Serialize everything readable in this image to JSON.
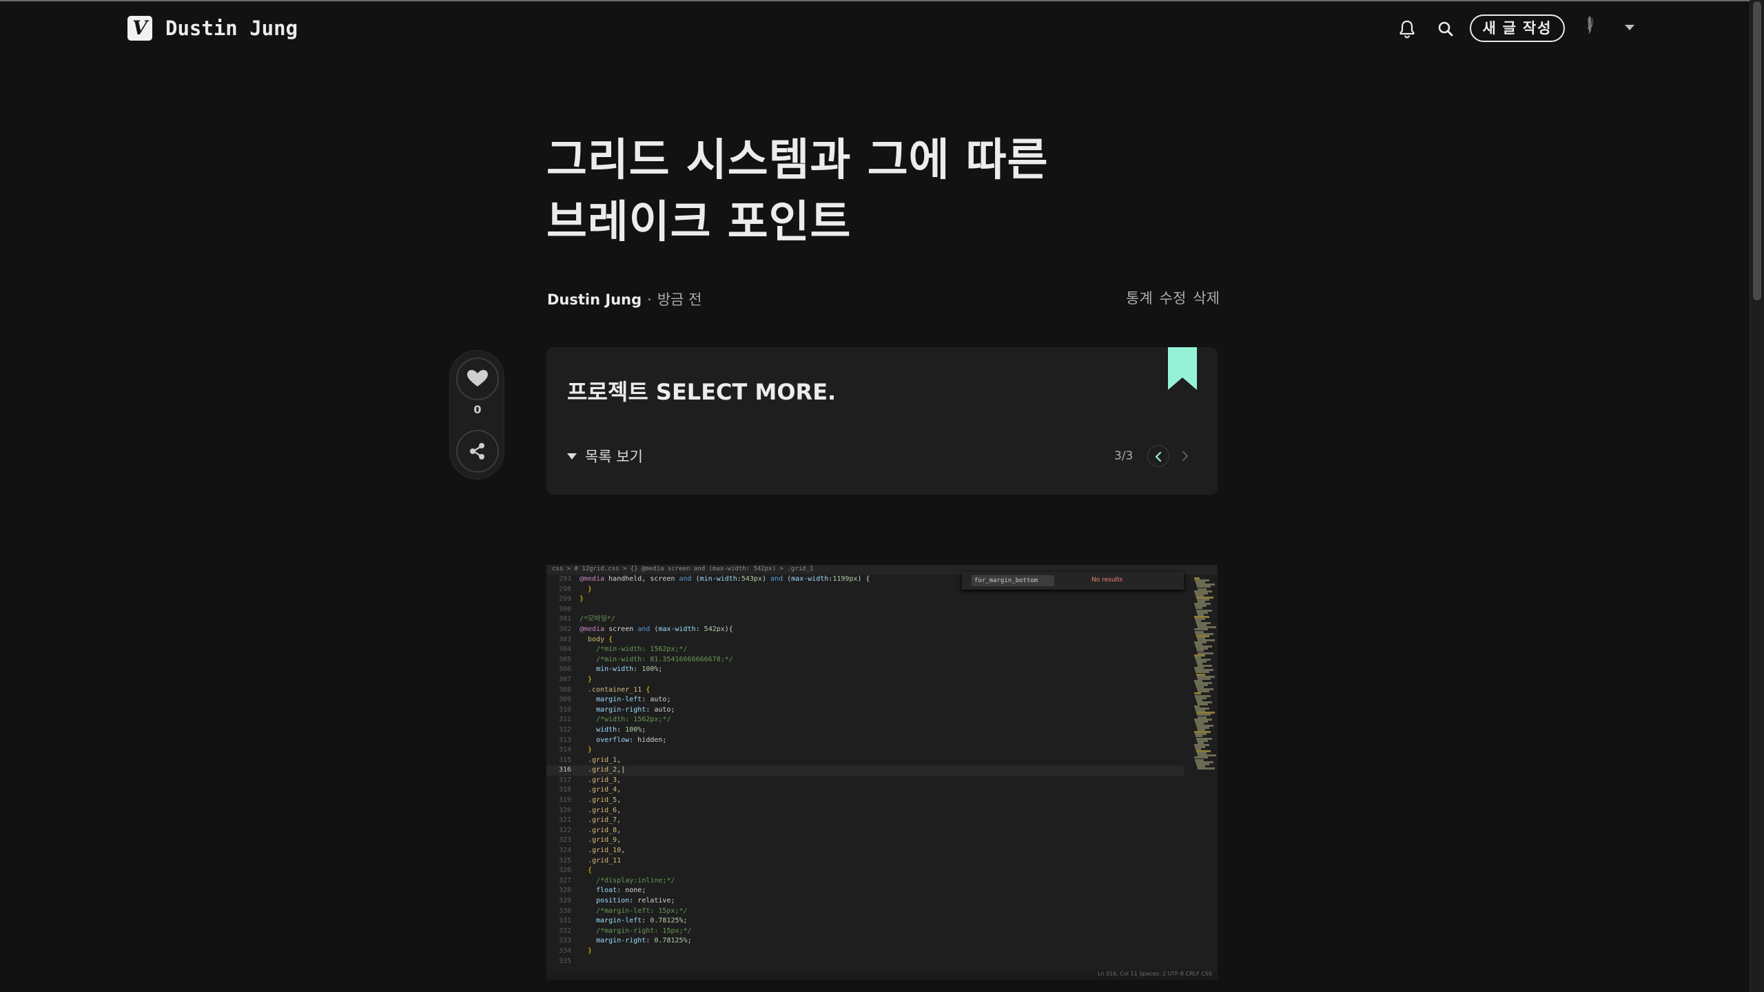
{
  "header": {
    "logo_letter": "V",
    "blog_title": "Dustin Jung",
    "new_post_label": "새 글 작성",
    "icons": [
      "bell-icon",
      "search-icon",
      "chevron-down-icon"
    ]
  },
  "post": {
    "title_line1": "그리드 시스템과 그에 따른",
    "title_line2": "브레이크 포인트",
    "author": "Dustin Jung",
    "separator": "·",
    "time": "방금 전",
    "actions": {
      "stats": "통계",
      "edit": "수정",
      "delete": "삭제"
    }
  },
  "side_actions": {
    "like_count": "0"
  },
  "series": {
    "name": "프로젝트 SELECT MORE.",
    "toc_label": "목록 보기",
    "progress": "3/3"
  },
  "code_image": {
    "breadcrumb": "css > # 12grid.css > {} @media screen and (max-width: 542px) > .grid_1",
    "find_query": "for_margin_bottom",
    "find_status": "No results",
    "status_text": "Ln 316, Col 11   Spaces: 2   UTF-8   CRLF   CSS",
    "lines": [
      {
        "n": "293",
        "html": "<span class='c-at'>@media</span> <span class='c-plain'>handheld, screen</span> <span class='c-kw'>and</span> <span class='c-plain'>(</span><span class='c-prop'>min-width</span><span class='c-plain'>:</span><span class='c-num'>543px</span><span class='c-plain'>)</span> <span class='c-kw'>and</span> <span class='c-plain'>(</span><span class='c-prop'>max-width</span><span class='c-plain'>:</span><span class='c-num'>1199px</span><span class='c-plain'>) {</span>"
      },
      {
        "n": "298",
        "html": "  <span class='c-brace'>}</span>"
      },
      {
        "n": "299",
        "html": "<span class='c-brace'>}</span>"
      },
      {
        "n": "300",
        "html": ""
      },
      {
        "n": "301",
        "html": "<span class='c-com'>/*모바일*/</span>"
      },
      {
        "n": "302",
        "html": "<span class='c-at'>@media</span> <span class='c-plain'>screen</span> <span class='c-kw'>and</span> <span class='c-plain'>(</span><span class='c-prop'>max-width</span><span class='c-plain'>: </span><span class='c-num'>542px</span><span class='c-plain'>){</span>"
      },
      {
        "n": "303",
        "html": "  <span class='c-sel'>body</span> <span class='c-brace'>{</span>"
      },
      {
        "n": "304",
        "html": "    <span class='c-com'>/*min-width: 1562px;*/</span>"
      },
      {
        "n": "305",
        "html": "    <span class='c-com'>/*min-width: 81.35416666666678;*/</span>"
      },
      {
        "n": "306",
        "html": "    <span class='c-prop'>min-width</span><span class='c-plain'>: </span><span class='c-num'>100%</span><span class='c-plain'>;</span>"
      },
      {
        "n": "307",
        "html": "  <span class='c-brace'>}</span>"
      },
      {
        "n": "308",
        "html": "  <span class='c-sel'>.container_11</span> <span class='c-brace'>{</span>"
      },
      {
        "n": "309",
        "html": "    <span class='c-prop'>margin-left</span><span class='c-plain'>: auto;</span>"
      },
      {
        "n": "310",
        "html": "    <span class='c-prop'>margin-right</span><span class='c-plain'>: auto;</span>"
      },
      {
        "n": "311",
        "html": "    <span class='c-com'>/*width: 1562px;*/</span>"
      },
      {
        "n": "312",
        "html": "    <span class='c-prop'>width</span><span class='c-plain'>: </span><span class='c-num'>100%</span><span class='c-plain'>;</span>"
      },
      {
        "n": "313",
        "html": "    <span class='c-prop'>overflow</span><span class='c-plain'>: hidden;</span>"
      },
      {
        "n": "314",
        "html": "  <span class='c-brace'>}</span>"
      },
      {
        "n": "315",
        "html": "  <span class='c-sel'>.grid_1</span><span class='c-plain'>,</span>"
      },
      {
        "n": "316",
        "html": "  <span class='c-sel'>.grid_2</span><span class='c-plain'>,|</span>",
        "current": true
      },
      {
        "n": "317",
        "html": "  <span class='c-sel'>.grid_3</span><span class='c-plain'>,</span>"
      },
      {
        "n": "318",
        "html": "  <span class='c-sel'>.grid_4</span><span class='c-plain'>,</span>"
      },
      {
        "n": "319",
        "html": "  <span class='c-sel'>.grid_5</span><span class='c-plain'>,</span>"
      },
      {
        "n": "320",
        "html": "  <span class='c-sel'>.grid_6</span><span class='c-plain'>,</span>"
      },
      {
        "n": "321",
        "html": "  <span class='c-sel'>.grid_7</span><span class='c-plain'>,</span>"
      },
      {
        "n": "322",
        "html": "  <span class='c-sel'>.grid_8</span><span class='c-plain'>,</span>"
      },
      {
        "n": "323",
        "html": "  <span class='c-sel'>.grid_9</span><span class='c-plain'>,</span>"
      },
      {
        "n": "324",
        "html": "  <span class='c-sel'>.grid_10</span><span class='c-plain'>,</span>"
      },
      {
        "n": "325",
        "html": "  <span class='c-sel'>.grid_11</span>"
      },
      {
        "n": "326",
        "html": "  <span class='c-brace'>{</span>"
      },
      {
        "n": "327",
        "html": "    <span class='c-com'>/*display:inline;*/</span>"
      },
      {
        "n": "328",
        "html": "    <span class='c-prop'>float</span><span class='c-plain'>: none;</span>"
      },
      {
        "n": "329",
        "html": "    <span class='c-prop'>position</span><span class='c-plain'>: relative;</span>"
      },
      {
        "n": "330",
        "html": "    <span class='c-com'>/*margin-left: 15px;*/</span>"
      },
      {
        "n": "331",
        "html": "    <span class='c-prop'>margin-left</span><span class='c-plain'>: </span><span class='c-num'>0.78125%</span><span class='c-plain'>;</span>"
      },
      {
        "n": "332",
        "html": "    <span class='c-com'>/*margin-right: 15px;*/</span>"
      },
      {
        "n": "333",
        "html": "    <span class='c-prop'>margin-right</span><span class='c-plain'>: </span><span class='c-num'>0.78125%</span><span class='c-plain'>;</span>"
      },
      {
        "n": "334",
        "html": "  <span class='c-brace'>}</span>"
      },
      {
        "n": "335",
        "html": ""
      }
    ]
  },
  "colors": {
    "background": "#121212",
    "surface": "#1e1e1e",
    "text": "#ececec",
    "muted": "#acacac",
    "accent": "#96f2d7"
  }
}
